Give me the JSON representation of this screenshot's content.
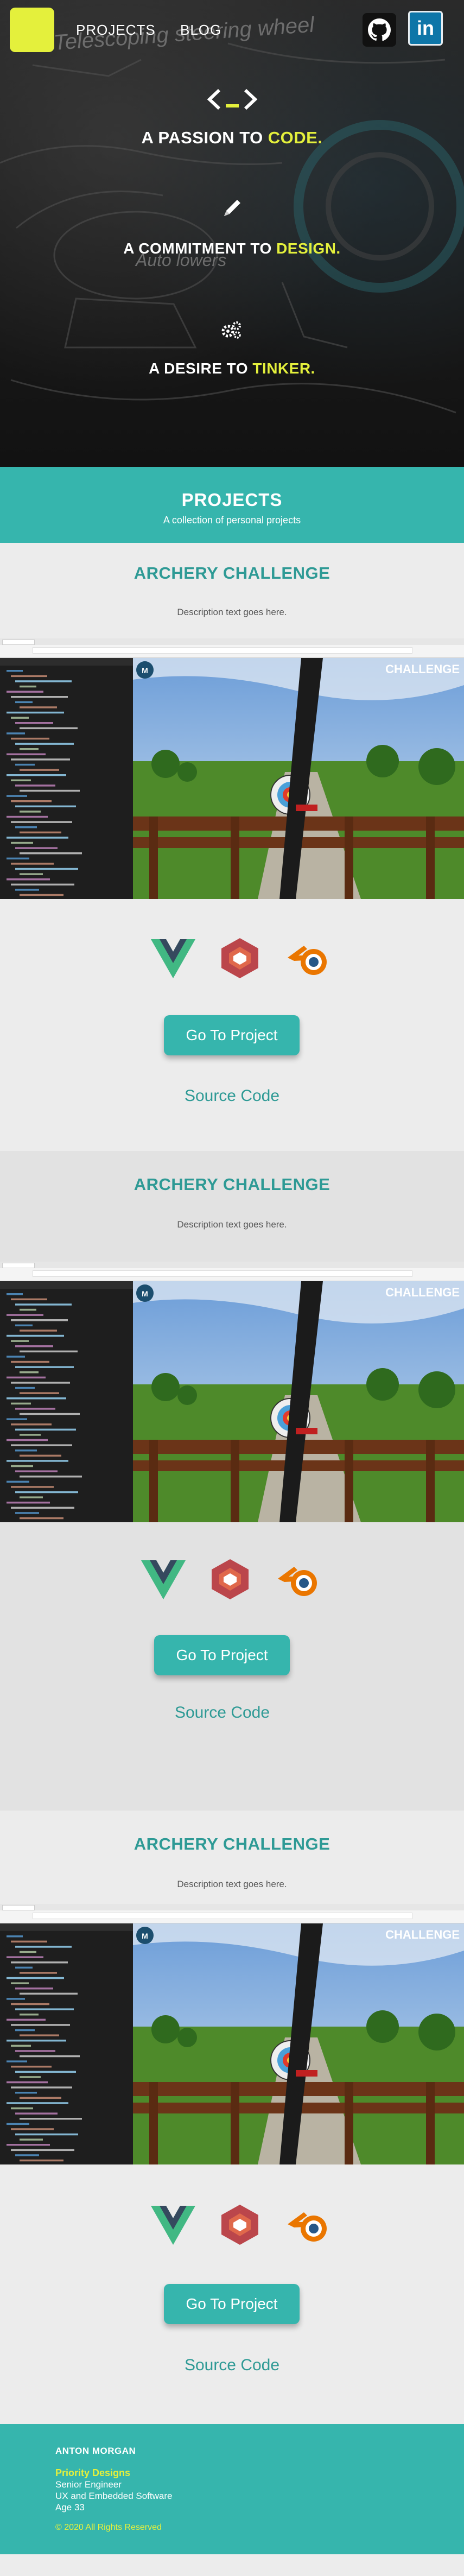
{
  "nav": {
    "links": [
      "PROJECTS",
      "BLOG"
    ],
    "github_icon": "github-icon",
    "linkedin_label": "in",
    "accent": "#e4f03c"
  },
  "hero": {
    "lines": [
      {
        "prefix": "A PASSION TO ",
        "highlight": "CODE."
      },
      {
        "prefix": "A COMMITMENT TO ",
        "highlight": "DESIGN."
      },
      {
        "prefix": "A DESIRE TO ",
        "highlight": "TINKER."
      }
    ],
    "sketch_text": [
      "Telescoping steering wheel",
      "Auto lowers"
    ]
  },
  "projects_header": {
    "title": "PROJECTS",
    "subtitle": "A collection of personal projects",
    "color": "#36b5ad"
  },
  "projects": [
    {
      "title": "ARCHERY CHALLENGE",
      "description": "Description text goes here.",
      "hud": "CHALLENGE",
      "tech_icons": [
        "vue-icon",
        "babylonjs-icon",
        "blender-icon"
      ],
      "button": "Go To Project",
      "source": "Source Code"
    },
    {
      "title": "ARCHERY CHALLENGE",
      "description": "Description text goes here.",
      "hud": "CHALLENGE",
      "tech_icons": [
        "vue-icon",
        "babylonjs-icon",
        "blender-icon"
      ],
      "button": "Go To Project",
      "source": "Source Code"
    },
    {
      "title": "ARCHERY CHALLENGE",
      "description": "Description text goes here.",
      "hud": "CHALLENGE",
      "tech_icons": [
        "vue-icon",
        "babylonjs-icon",
        "blender-icon"
      ],
      "button": "Go To Project",
      "source": "Source Code"
    }
  ],
  "footer": {
    "name": "ANTON MORGAN",
    "company": "Priority Designs",
    "role": "Senior Engineer",
    "field": "UX and Embedded Software",
    "age": "Age 33",
    "copyright": "© 2020 All Rights Reserved"
  }
}
